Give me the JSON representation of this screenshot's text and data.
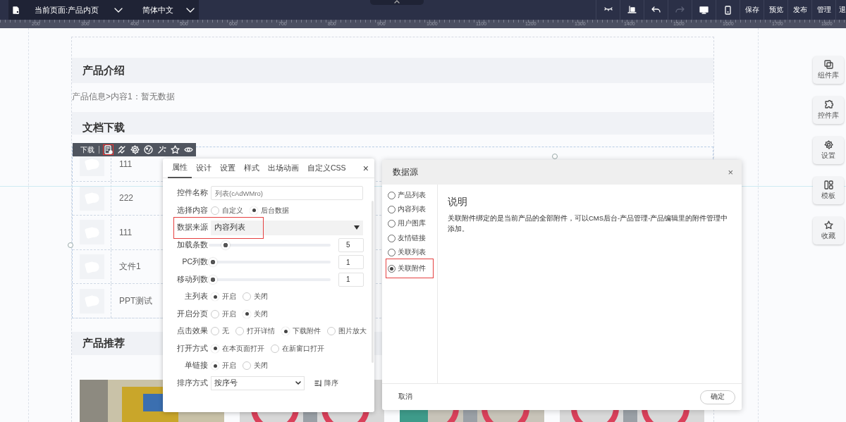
{
  "topbar": {
    "page_selector": "当前页面:产品内页",
    "language_selector": "简体中文",
    "tool_icons": [
      {
        "disabled": false
      },
      {
        "disabled": false
      },
      {
        "disabled": false
      },
      {
        "disabled": true
      },
      {
        "disabled": false
      },
      {
        "disabled": false
      }
    ],
    "text_buttons": [
      "保存",
      "预览",
      "发布",
      "管理",
      "退"
    ]
  },
  "ruler": [
    "200",
    "300",
    "400",
    "500",
    "600",
    "700",
    "800",
    "900",
    "1000",
    "1100",
    "1200",
    "1300",
    "1400",
    "1500",
    "1600",
    "1700",
    "1800"
  ],
  "page": {
    "intro_title": "产品介绍",
    "intro_text": "产品信息>内容1：暂无数据",
    "download_title": "文档下载",
    "toolbar": {
      "label": "下载",
      "icons": [
        {
          "highlighted": true
        },
        {
          "highlighted": false
        },
        {
          "highlighted": false
        },
        {
          "highlighted": false
        },
        {
          "highlighted": false
        },
        {
          "highlighted": false
        },
        {
          "highlighted": false
        }
      ]
    },
    "files": [
      "111",
      "222",
      "111",
      "文件1",
      "PPT测试"
    ],
    "recommend_title": "产品推荐",
    "products": [
      {
        "kind": "picture"
      },
      {
        "kind": "picture"
      },
      {
        "kind": "picture"
      },
      {
        "kind": "picture"
      }
    ]
  },
  "properties": {
    "close": "×",
    "tabs": [
      {
        "label": "属性",
        "selected": true
      },
      {
        "label": "设计",
        "selected": false
      },
      {
        "label": "设置",
        "selected": false
      },
      {
        "label": "样式",
        "selected": false
      },
      {
        "label": "出场动画",
        "selected": false
      },
      {
        "label": "自定义CSS",
        "selected": false
      }
    ],
    "fields": [
      {
        "kind": "text",
        "label": "控件名称",
        "placeholder": "列表(cAdWMro)"
      },
      {
        "kind": "radio",
        "label": "选择内容",
        "options": [
          {
            "label": "自定义",
            "selected": false
          },
          {
            "label": "后台数据",
            "selected": true
          }
        ]
      },
      {
        "kind": "select",
        "label": "数据来源",
        "value": "内容列表",
        "highlighted": true
      },
      {
        "kind": "slider",
        "label": "加载条数",
        "level": 0.11,
        "value": "5"
      },
      {
        "kind": "slider",
        "label": "PC列数",
        "level": 0,
        "value": "1"
      },
      {
        "kind": "slider",
        "label": "移动列数",
        "level": 0,
        "value": "1"
      },
      {
        "kind": "radio",
        "label": "主列表",
        "options": [
          {
            "label": "开启",
            "selected": true
          },
          {
            "label": "关闭",
            "selected": false
          }
        ]
      },
      {
        "kind": "radio",
        "label": "开启分页",
        "options": [
          {
            "label": "开启",
            "selected": false
          },
          {
            "label": "关闭",
            "selected": true
          }
        ]
      },
      {
        "kind": "radio",
        "label": "点击效果",
        "options": [
          {
            "label": "无",
            "selected": false
          },
          {
            "label": "打开详情",
            "selected": false
          },
          {
            "label": "下载附件",
            "selected": true
          },
          {
            "label": "图片放大",
            "selected": false
          }
        ]
      },
      {
        "kind": "radio",
        "label": "打开方式",
        "options": [
          {
            "label": "在本页面打开",
            "selected": true
          },
          {
            "label": "在新窗口打开",
            "selected": false
          }
        ]
      },
      {
        "kind": "radio",
        "label": "单链接",
        "options": [
          {
            "label": "开启",
            "selected": true
          },
          {
            "label": "关闭",
            "selected": false
          }
        ]
      },
      {
        "kind": "sort",
        "label": "排序方式",
        "value": "按序号",
        "order": "降序"
      }
    ]
  },
  "data_source": {
    "title": "数据源",
    "close": "×",
    "options": [
      {
        "label": "产品列表",
        "selected": false,
        "highlighted": false
      },
      {
        "label": "内容列表",
        "selected": false,
        "highlighted": false
      },
      {
        "label": "用户图库",
        "selected": false,
        "highlighted": false
      },
      {
        "label": "友情链接",
        "selected": false,
        "highlighted": false
      },
      {
        "label": "关联列表",
        "selected": false,
        "highlighted": false
      },
      {
        "label": "关联附件",
        "selected": true,
        "highlighted": true
      }
    ],
    "heading": "说明",
    "description": "关联附件绑定的是当前产品的全部附件，可以CMS后台-产品管理-产品编辑里的附件管理中添加。",
    "cancel": "取消",
    "ok": "确定"
  },
  "side_tools": [
    "组件库",
    "控件库",
    "设置",
    "模板",
    "收藏"
  ]
}
